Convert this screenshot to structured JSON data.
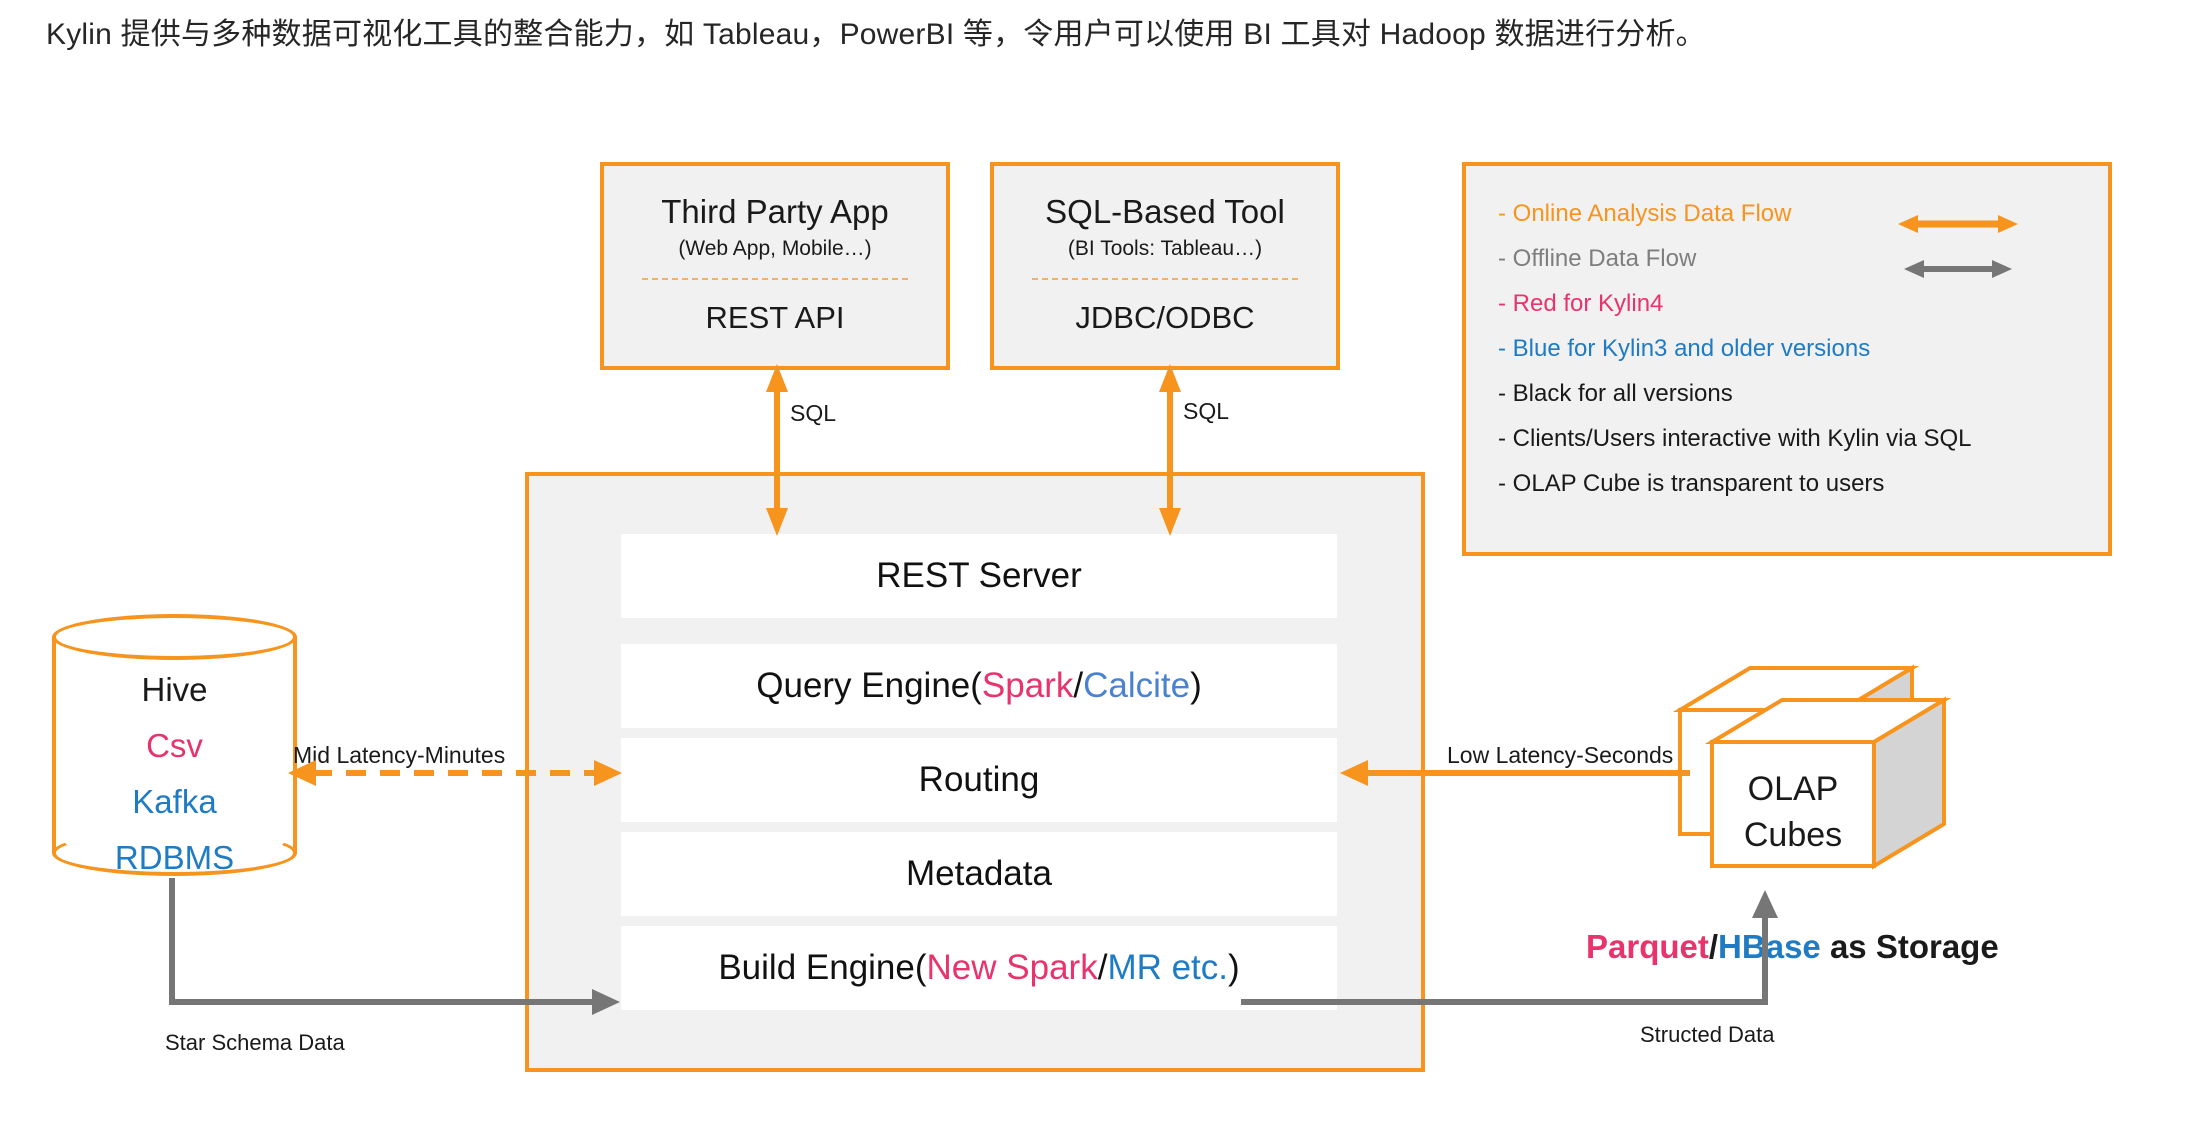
{
  "caption": "Kylin 提供与多种数据可视化工具的整合能力，如 Tableau，PowerBI 等，令用户可以使用 BI 工具对 Hadoop 数据进行分析。",
  "colors": {
    "orange": "#F7941E",
    "gray": "#767676",
    "pink": "#E8336D",
    "blue": "#1E7BC4",
    "calcite_blue": "#4A82D2",
    "panel_fill": "#F1F1F1"
  },
  "clients": [
    {
      "title": "Third Party App",
      "subtitle": "(Web App, Mobile…)",
      "api": "REST API",
      "connector_label": "SQL"
    },
    {
      "title": "SQL-Based Tool",
      "subtitle": "(BI Tools: Tableau…)",
      "api": "JDBC/ODBC",
      "connector_label": "SQL"
    }
  ],
  "legend": {
    "rows": [
      {
        "text": "- Online Analysis Data Flow",
        "color_key": "online",
        "arrow": "orange-double"
      },
      {
        "text": "- Offline Data Flow",
        "color_key": "offline",
        "arrow": "gray-double"
      },
      {
        "text": "- Red for Kylin4",
        "color_key": "red",
        "arrow": "none"
      },
      {
        "text": "- Blue for Kylin3 and older versions",
        "color_key": "blue",
        "arrow": "none"
      },
      {
        "text": "- Black for all versions",
        "color_key": "black",
        "arrow": "none"
      },
      {
        "text": "- Clients/Users interactive with Kylin via SQL",
        "color_key": "black",
        "arrow": "none"
      },
      {
        "text": "- OLAP Cube is transparent to users",
        "color_key": "black",
        "arrow": "none"
      }
    ]
  },
  "kylin": {
    "layers": [
      {
        "parts": [
          {
            "t": "REST Server",
            "c": "black"
          }
        ]
      },
      {
        "parts": [
          {
            "t": "Query Engine(",
            "c": "black"
          },
          {
            "t": "Spark",
            "c": "pink"
          },
          {
            "t": "/",
            "c": "black"
          },
          {
            "t": "Calcite",
            "c": "calcite"
          },
          {
            "t": ")",
            "c": "black"
          }
        ]
      },
      {
        "parts": [
          {
            "t": "Routing",
            "c": "black"
          }
        ]
      },
      {
        "parts": [
          {
            "t": "Metadata",
            "c": "black"
          }
        ]
      },
      {
        "parts": [
          {
            "t": "Build Engine(",
            "c": "black"
          },
          {
            "t": "New Spark",
            "c": "pink"
          },
          {
            "t": "/",
            "c": "black"
          },
          {
            "t": "MR etc.",
            "c": "blue"
          },
          {
            "t": ")",
            "c": "black"
          }
        ]
      }
    ]
  },
  "datasource": {
    "items": [
      {
        "text": "Hive",
        "color_key": "black"
      },
      {
        "text": "Csv",
        "color_key": "pink"
      },
      {
        "text": "Kafka",
        "color_key": "blue"
      },
      {
        "text": "RDBMS",
        "color_key": "blue"
      }
    ]
  },
  "cubes": {
    "line1": "OLAP",
    "line2": "Cubes"
  },
  "storage_label": {
    "parts": [
      {
        "t": "Parquet",
        "c": "pink"
      },
      {
        "t": "/",
        "c": "black"
      },
      {
        "t": "HBase",
        "c": "blue"
      },
      {
        "t": " as Storage",
        "c": "black"
      }
    ]
  },
  "flow_labels": {
    "mid_latency": "Mid Latency-Minutes",
    "low_latency": "Low Latency-Seconds",
    "star_schema": "Star Schema Data",
    "structed": "Structed Data"
  }
}
